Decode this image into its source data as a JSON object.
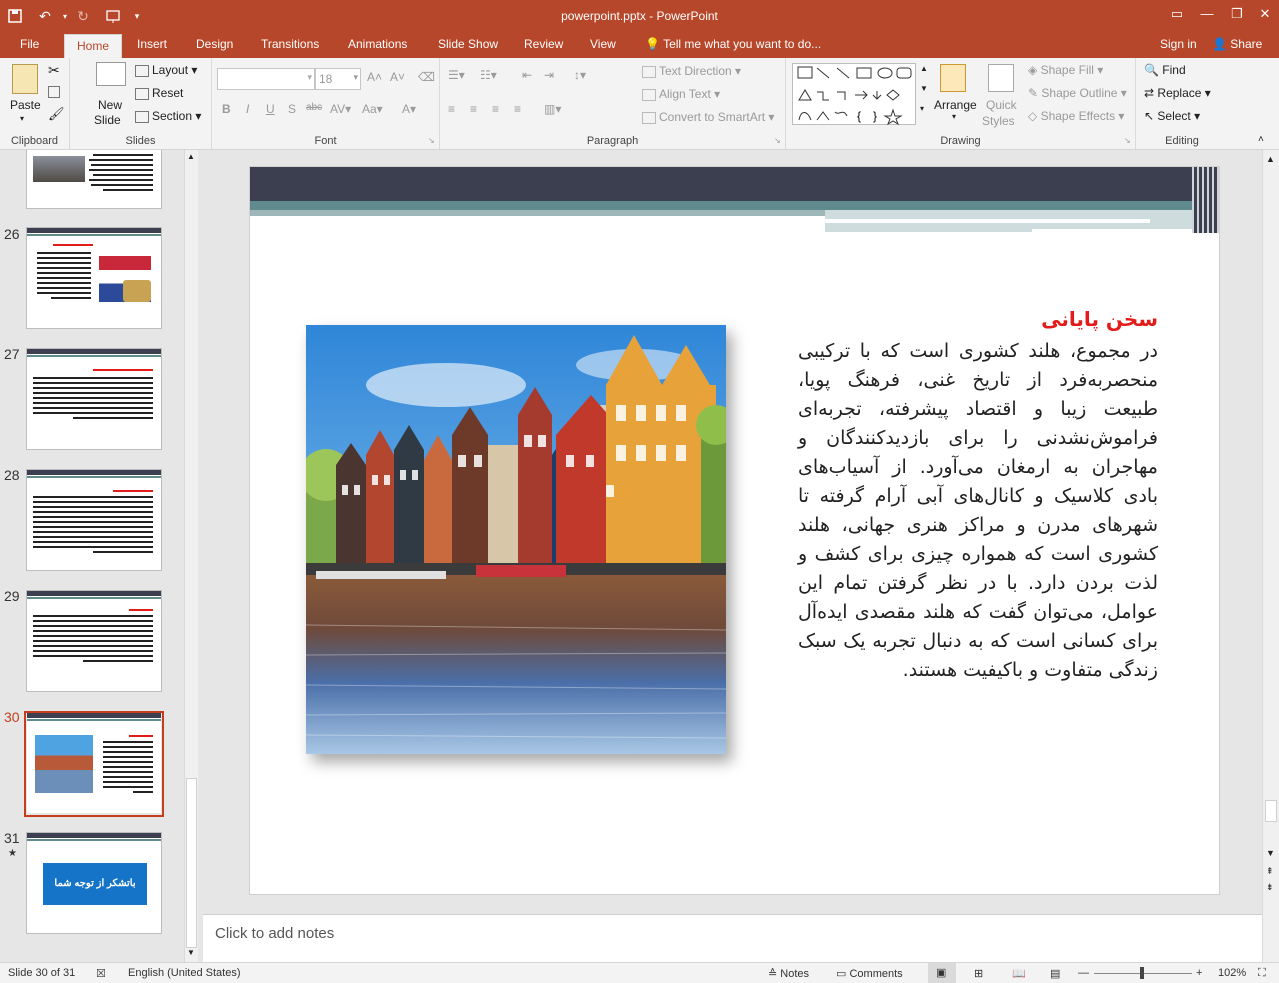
{
  "window": {
    "title": "powerpoint.pptx - PowerPoint"
  },
  "tabs": {
    "file": "File",
    "home": "Home",
    "insert": "Insert",
    "design": "Design",
    "transitions": "Transitions",
    "animations": "Animations",
    "slideshow": "Slide Show",
    "review": "Review",
    "view": "View",
    "tellme": "Tell me what you want to do...",
    "signin": "Sign in",
    "share": "Share"
  },
  "ribbon": {
    "clipboard": {
      "label": "Clipboard",
      "paste": "Paste"
    },
    "slides": {
      "label": "Slides",
      "new_slide": "New",
      "new_slide2": "Slide",
      "layout": "Layout",
      "reset": "Reset",
      "section": "Section"
    },
    "font": {
      "label": "Font",
      "font_name": "",
      "font_size": "18"
    },
    "paragraph": {
      "label": "Paragraph",
      "text_direction": "Text Direction",
      "align_text": "Align Text",
      "convert_smartart": "Convert to SmartArt"
    },
    "drawing": {
      "label": "Drawing",
      "arrange": "Arrange",
      "quick_styles1": "Quick",
      "quick_styles2": "Styles",
      "shape_fill": "Shape Fill",
      "shape_outline": "Shape Outline",
      "shape_effects": "Shape Effects"
    },
    "editing": {
      "label": "Editing",
      "find": "Find",
      "replace": "Replace",
      "select": "Select"
    }
  },
  "thumbnails": [
    {
      "number": ""
    },
    {
      "number": "26"
    },
    {
      "number": "27"
    },
    {
      "number": "28"
    },
    {
      "number": "29"
    },
    {
      "number": "30"
    },
    {
      "number": "31",
      "button_text": "باتشکر از توجه شما"
    }
  ],
  "slide": {
    "title": "سخن پایانی",
    "body": "در مجموع، هلند کشوری است که با ترکیبی منحصربه‌فرد از تاریخ غنی، فرهنگ پویا، طبیعت زیبا و اقتصاد پیشرفته، تجربه‌ای فراموش‌نشدنی را برای بازدیدکنندگان و مهاجران به ارمغان می‌آورد. از آسیاب‌های بادی کلاسیک و کانال‌های آبی آرام گرفته تا شهرهای مدرن و مراکز هنری جهانی، هلند کشوری است که همواره چیزی برای کشف و لذت بردن دارد. با در نظر گرفتن تمام این عوامل، می‌توان گفت که هلند مقصدی ایده‌آل برای کسانی است که به دنبال تجربه یک سبک زندگی متفاوت و باکیفیت هستند.",
    "title_color": "#e31b1b"
  },
  "notes": {
    "placeholder": "Click to add notes"
  },
  "status": {
    "slide": "Slide 30 of 31",
    "language": "English (United States)",
    "notes": "Notes",
    "comments": "Comments",
    "zoom": "102%"
  },
  "colors": {
    "accent": "#b7472a",
    "header_dark": "#3b3f4f",
    "header_teal": "#5f8b8e"
  }
}
